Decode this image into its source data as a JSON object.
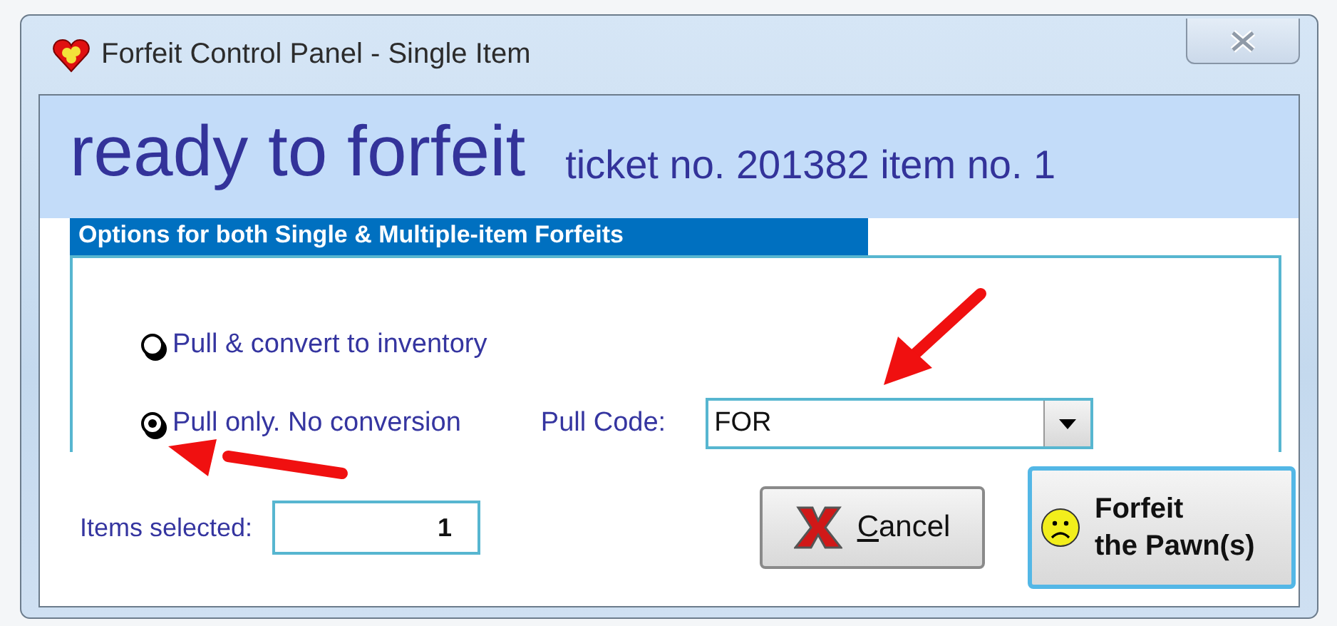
{
  "window": {
    "title": "Forfeit Control Panel - Single Item"
  },
  "header": {
    "status": "ready to forfeit",
    "ticket": "ticket no. 201382 item no. 1"
  },
  "options_group": {
    "title": "Options for both Single & Multiple-item Forfeits",
    "options": [
      {
        "label": "Pull & convert to inventory",
        "selected": false
      },
      {
        "label": "Pull only. No conversion",
        "selected": true
      }
    ],
    "pull_code": {
      "label": "Pull Code:",
      "value": "FOR"
    }
  },
  "items_selected": {
    "label": "Items selected:",
    "value": "1"
  },
  "buttons": [
    {
      "kind": "cancel",
      "label": "Cancel",
      "default": false
    },
    {
      "kind": "forfeit",
      "label": "Forfeit\nthe Pawn(s)",
      "default": true
    }
  ]
}
